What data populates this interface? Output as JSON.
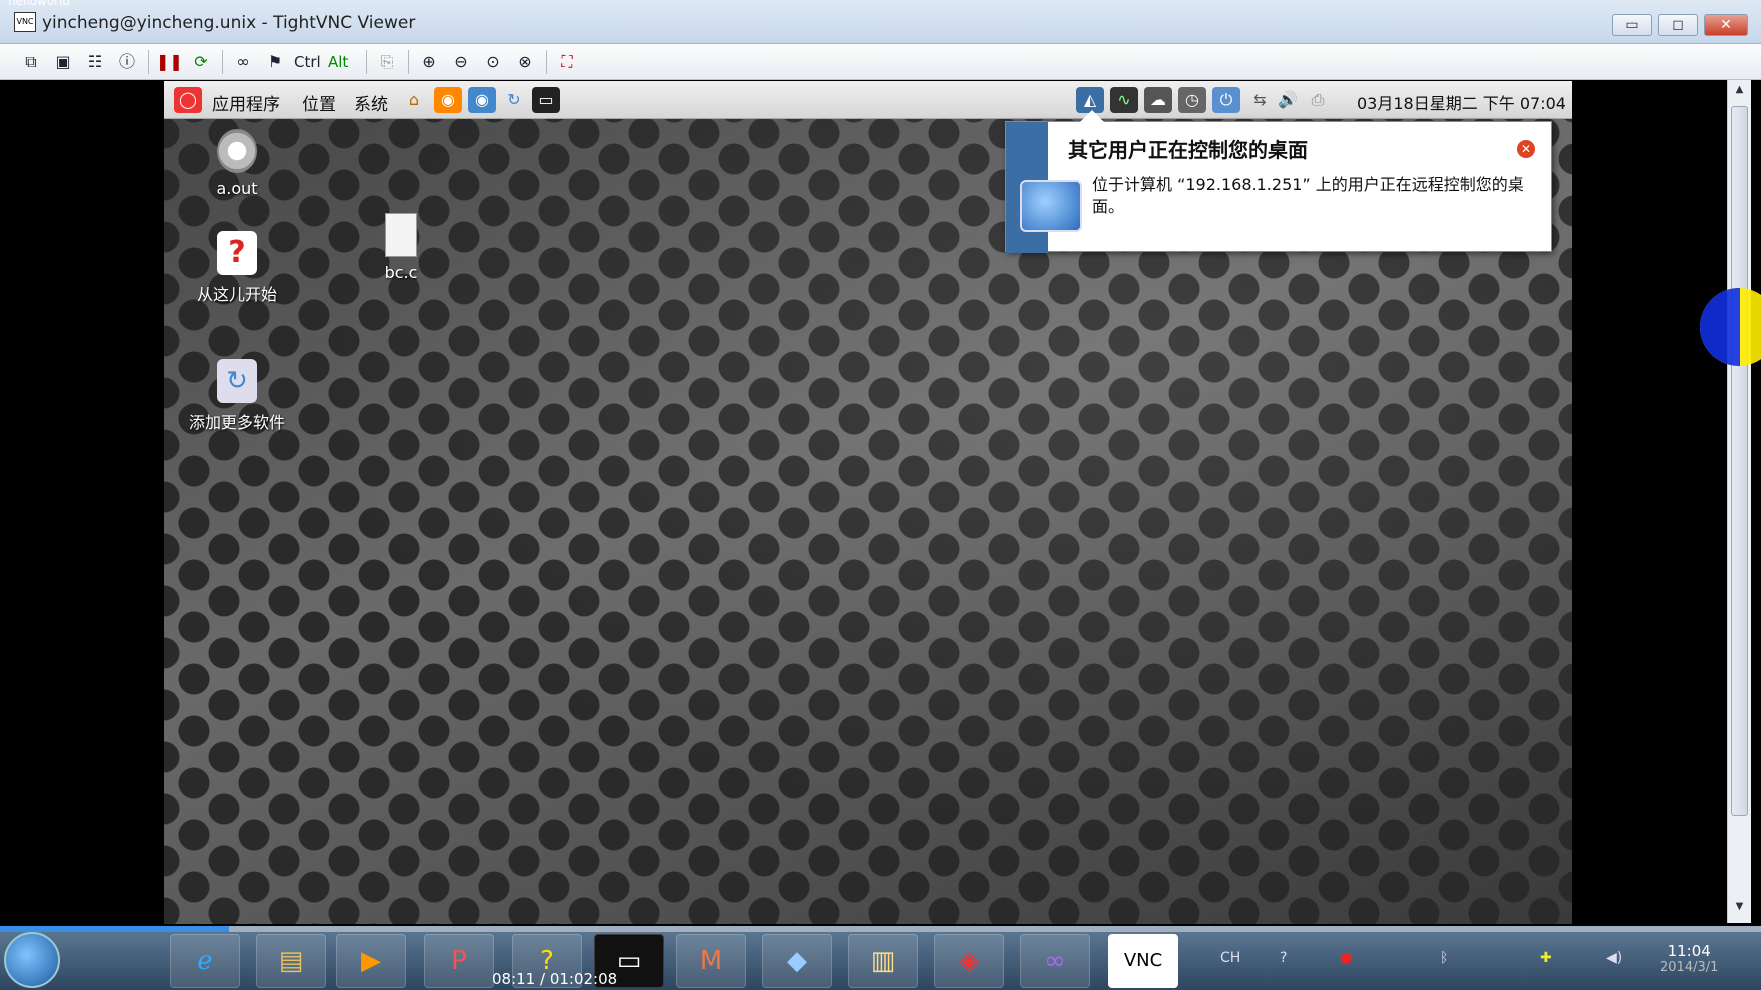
{
  "window": {
    "title": "yincheng@yincheng.unix - TightVNC Viewer",
    "logo_text": "VNC",
    "behind_title": "helloworld",
    "controls": {
      "min": "▭",
      "max": "◻",
      "close": "✕"
    }
  },
  "toolbar": {
    "ctrl_label": "Ctrl",
    "alt_label": "Alt"
  },
  "remote": {
    "panel": {
      "menus": [
        "应用程序",
        "位置",
        "系统"
      ],
      "clock": "03月18日星期二 下午 07:04"
    },
    "desktop_icons": [
      {
        "label": "a.out"
      },
      {
        "label": "bc.c"
      },
      {
        "label": "从这儿开始"
      },
      {
        "label": "添加更多软件"
      }
    ],
    "notification": {
      "title": "其它用户正在控制您的桌面",
      "body": "位于计算机 “192.168.1.251” 上的用户正在远程控制您的桌面。"
    }
  },
  "taskbar": {
    "timecode": "08:11 / 01:02:08",
    "progress_fraction": 0.13,
    "tray": {
      "lang": "CH"
    },
    "clock": {
      "time": "11:04",
      "date": "2014/3/1"
    }
  },
  "colors": {
    "notify_sidebar": "#3b6ea5",
    "taskbar": "#2e4660",
    "cursor_highlight_yellow": "#ffee00",
    "cursor_highlight_blue": "#1030e0"
  }
}
